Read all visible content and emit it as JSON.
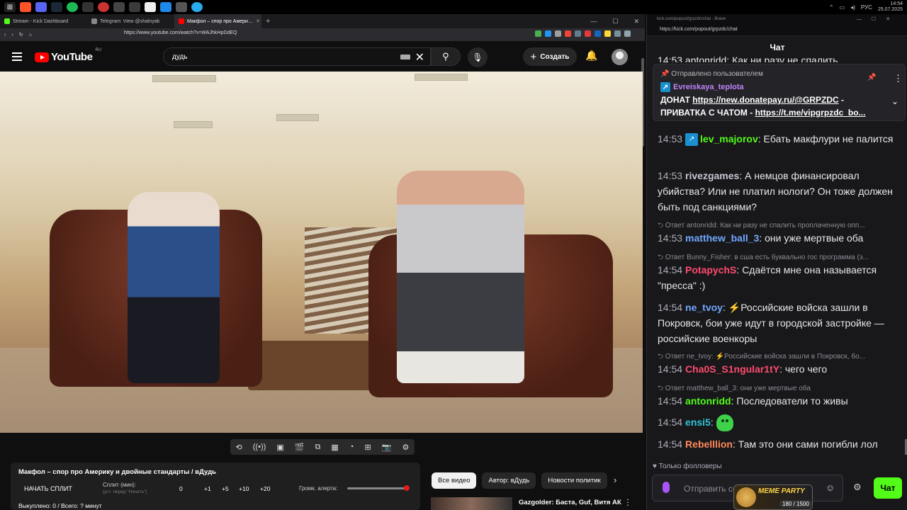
{
  "taskbar": {
    "lang": "РУС",
    "time": "14:54",
    "date": "25.07.2025"
  },
  "browser": {
    "tabs": [
      {
        "label": "Stream - Kick Dashboard",
        "color": "#53fc18"
      },
      {
        "label": "Telegram: View @shalnyak",
        "color": "#888888"
      },
      {
        "label": "Макфол – спор про Амери…",
        "color": "#ff0000"
      }
    ],
    "url": "https://www.youtube.com/watch?v=WAJhkHpDdEQ"
  },
  "youtube": {
    "logo": "YouTube",
    "region": "RU",
    "search_value": "дудь",
    "create_label": "Создать",
    "video_title": "Макфол – спор про Америку и двойные стандарты / вДудь"
  },
  "split": {
    "start_label": "НАЧАТЬ СПЛИТ",
    "split_min_label": "Сплит (мин):",
    "split_hint": "(уст. перед \"Начать\")",
    "values": [
      "0",
      "+1",
      "+5",
      "+10",
      "+20"
    ],
    "alert_label": "Громк. алерта:",
    "alert_level": 1.0,
    "footer": "Выкуплено: 0 / Всего: ? минут"
  },
  "chips": [
    "Все видео",
    "Автор: вДудь",
    "Новости политик"
  ],
  "recommendation": {
    "title": "Gazgolder: Баста, Guf, Витя АК"
  },
  "chat": {
    "window_title": "kick.com/popout/grpzdc/chat - Brave",
    "url": "https://kick.com/popout/grpzdc/chat",
    "header": "Чат",
    "top_partial": "14:53  antonridd: Как ни разу не спалить",
    "pinned": {
      "head": "Отправлено пользователем",
      "user": "Evreiskaya_teplota",
      "line1_prefix": "ДОНАТ ",
      "line1_link": "https://new.donatepay.ru/@GRPZDC",
      "line1_suffix": " -",
      "line2_prefix": "ПРИВАТКА С ЧАТОМ - ",
      "line2_link": "https://t.me/vipgrpzdc_bo..."
    },
    "messages": [
      {
        "time": "14:53",
        "user": "lev_majorov",
        "color": "#53fc18",
        "text": "Ебать макфлури не палится"
      },
      {
        "time": "14:53",
        "user": "rivezgames",
        "color": "#c6c6d0",
        "text": "А немцов финансировал убийства? Или не платил нологи? Он тоже должен быть под санкциями?"
      },
      {
        "time": "14:53",
        "user": "matthew_ball_3",
        "color": "#6fa8ff",
        "text": "они уже мертвые оба"
      },
      {
        "time": "14:54",
        "user": "PotapychS",
        "color": "#ff4b6e",
        "text": "Сдаётся мне она называется \"пресса\" :)"
      },
      {
        "time": "14:54",
        "user": "ne_tvoy",
        "color": "#6fa8ff",
        "text": "Российские войска зашли в Покровск, бои уже идут в городской застройке — российские военкоры"
      },
      {
        "time": "14:54",
        "user": "Cha0S_S1ngular1tY",
        "color": "#ff4b6e",
        "text": "чего чего"
      },
      {
        "time": "14:54",
        "user": "antonridd",
        "color": "#53fc18",
        "text": "Последователи то живы"
      },
      {
        "time": "14:54",
        "user": "ensi5",
        "color": "#2ec4d6",
        "text": ""
      },
      {
        "time": "14:54",
        "user": "Rebelllion",
        "color": "#ff8a5b",
        "text": "Там это они сами погибли лол"
      }
    ],
    "replies": [
      "Ответ antonridd: Как ни разу не спалить проплаченную опп...",
      "Ответ Bunny_Fisher: в сша есть буквально гос программа (з...",
      "Ответ ne_tvoy: ⚡Российские войска зашли в Покровск, бо...",
      "Ответ matthew_ball_3: они уже мертвые оба"
    ],
    "followers_only": "Только фолловеры",
    "input_placeholder": "Отправить сообщение",
    "send_label": "Чат",
    "meme": {
      "title": "MEME PARTY",
      "count": "180 / 1500"
    }
  }
}
